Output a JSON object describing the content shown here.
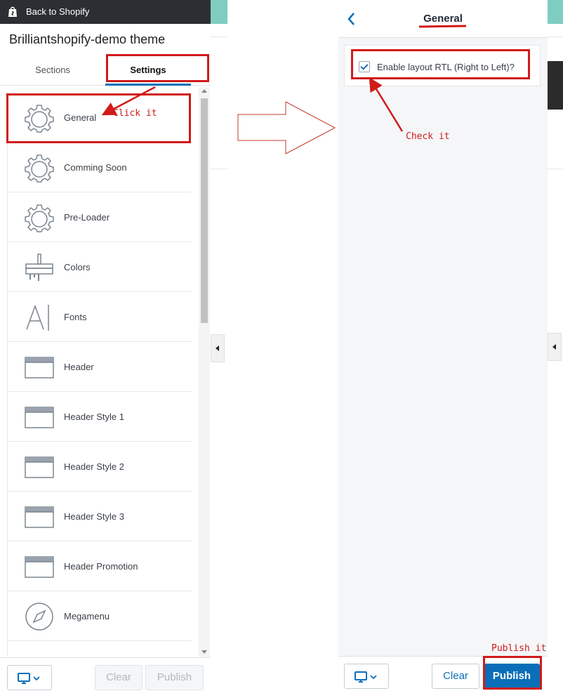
{
  "left_panel": {
    "back_label": "Back to Shopify",
    "theme_name": "Brilliantshopify-demo theme",
    "tabs": [
      {
        "label": "Sections"
      },
      {
        "label": "Settings"
      }
    ],
    "items": [
      {
        "label": "General",
        "icon": "gear-icon"
      },
      {
        "label": "Comming Soon",
        "icon": "gear-icon"
      },
      {
        "label": "Pre-Loader",
        "icon": "gear-icon"
      },
      {
        "label": "Colors",
        "icon": "paint-roller-icon"
      },
      {
        "label": "Fonts",
        "icon": "font-icon"
      },
      {
        "label": "Header",
        "icon": "header-layout-icon"
      },
      {
        "label": "Header Style 1",
        "icon": "header-layout-icon"
      },
      {
        "label": "Header Style 2",
        "icon": "header-layout-icon"
      },
      {
        "label": "Header Style 3",
        "icon": "header-layout-icon"
      },
      {
        "label": "Header Promotion",
        "icon": "header-layout-icon"
      },
      {
        "label": "Megamenu",
        "icon": "compass-icon"
      }
    ],
    "footer": {
      "clear_label": "Clear",
      "publish_label": "Publish"
    }
  },
  "right_panel": {
    "title": "General",
    "option_label": "Enable layout RTL (Right to Left)?",
    "option_checked": true,
    "footer": {
      "clear_label": "Clear",
      "publish_label": "Publish"
    }
  },
  "annotations": {
    "click_it": "Click it",
    "check_it": "Check it",
    "publish_it": "Publish it"
  },
  "colors": {
    "accent": "#0a6fb8",
    "topbar": "#2b2f33",
    "annotation": "#d11a1a",
    "preview_teal": "#7ecdc0"
  }
}
